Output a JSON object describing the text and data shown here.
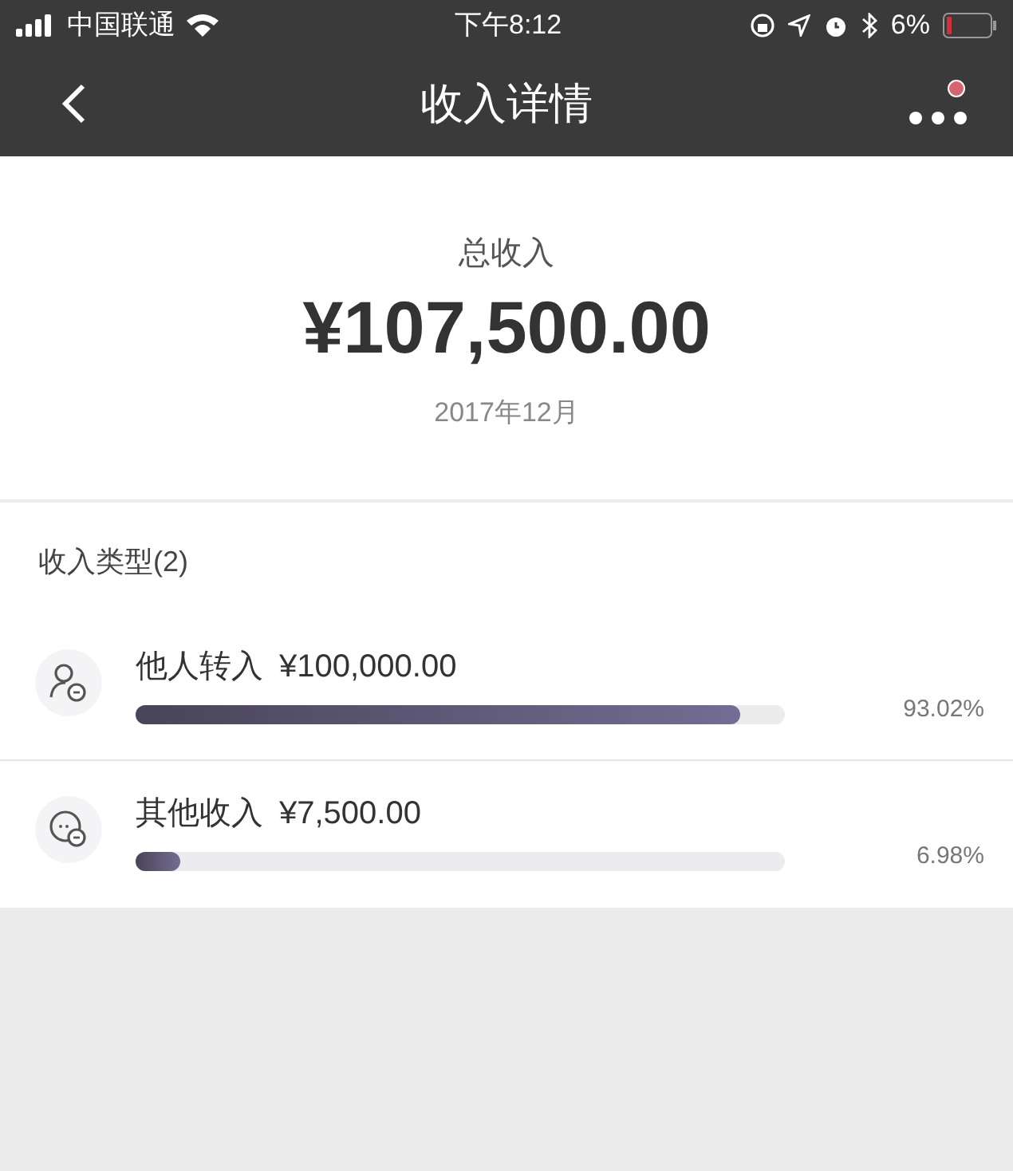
{
  "status_bar": {
    "carrier": "中国联通",
    "time": "下午8:12",
    "battery": "6%"
  },
  "nav": {
    "title": "收入详情",
    "has_notification": true
  },
  "summary": {
    "label": "总收入",
    "amount": "¥107,500.00",
    "period": "2017年12月"
  },
  "section": {
    "title": "收入类型(2)"
  },
  "items": [
    {
      "kind": "person",
      "name": "他人转入",
      "amount": "¥100,000.00",
      "level": 0.9302,
      "percent": "93.02%"
    },
    {
      "kind": "chat",
      "name": "其他收入",
      "amount": "¥7,500.00",
      "level": 0.0698,
      "percent": "6.98%"
    }
  ]
}
